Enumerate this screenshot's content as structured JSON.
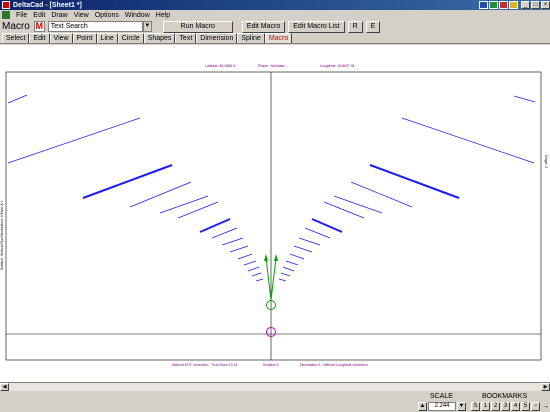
{
  "window": {
    "title": "DeltaCad - [Sheet1 *]"
  },
  "menu": [
    "File",
    "Edit",
    "Draw",
    "View",
    "Options",
    "Window",
    "Help"
  ],
  "toolbar": {
    "label": "Macro",
    "macro_icon": "M",
    "combo_value": "Text Search",
    "run_label": "Run Macro",
    "edit_label": "Edit Macro",
    "edit_list_label": "Edit Macro List",
    "r_label": "R",
    "e_label": "E"
  },
  "tabs": [
    "Select",
    "Edit",
    "View",
    "Point",
    "Line",
    "Circle",
    "Shapes",
    "Text",
    "Dimension",
    "Spline",
    "Macro"
  ],
  "active_tab": "Macro",
  "drawing": {
    "top_labels": [
      "Latitude: 55.2888 N",
      "Phase - Meridian",
      "Longitude: 16.8057 W"
    ],
    "bottom_labels": [
      "Without EOT correction - True Noon 13:14",
      "Rotation 0",
      "Declination 0 - Without Longitude correction"
    ],
    "left_label": "Surface: Vertical Dial Declination: 0 East. A.I.",
    "right_label": "Origin: 2",
    "line_color": "#1a1aff",
    "accent_color": "#c000c0",
    "marker_color": "#00a000"
  },
  "status": {
    "scale_label": "SCALE",
    "scale_value": "2.244",
    "bookmarks_label": "BOOKMARKS",
    "bookmarks": [
      "S",
      "1",
      "2",
      "3",
      "4",
      "5"
    ]
  }
}
